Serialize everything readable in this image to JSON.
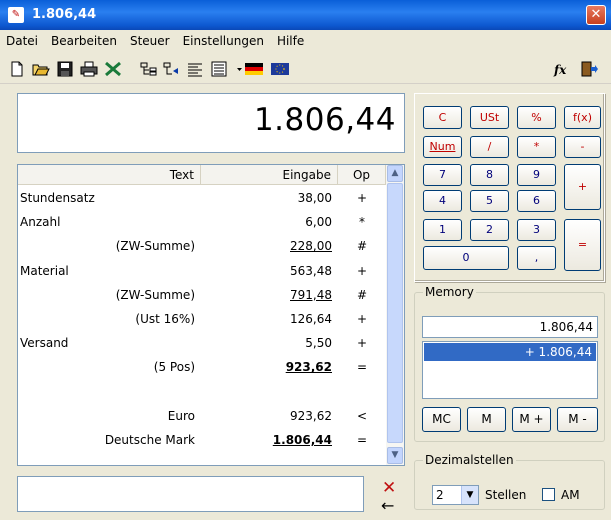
{
  "window": {
    "title": "1.806,44",
    "close_label": "✕"
  },
  "menu": [
    "Datei",
    "Bearbeiten",
    "Steuer",
    "Einstellungen",
    "Hilfe"
  ],
  "display": {
    "value": "1.806,44"
  },
  "grid": {
    "headers": {
      "text": "Text",
      "eingabe": "Eingabe",
      "op": "Op"
    },
    "rows": [
      {
        "text": "Stundensatz",
        "eingabe": "38,00",
        "op": "+"
      },
      {
        "text": "Anzahl",
        "eingabe": "6,00",
        "op": "*"
      },
      {
        "text": "(ZW-Summe)",
        "eingabe": "228,00",
        "op": "#"
      },
      {
        "text": "Material",
        "eingabe": "563,48",
        "op": "+"
      },
      {
        "text": "(ZW-Summe)",
        "eingabe": "791,48",
        "op": "#"
      },
      {
        "text": "(Ust 16%)",
        "eingabe": "126,64",
        "op": "+"
      },
      {
        "text": "Versand",
        "eingabe": "5,50",
        "op": "+"
      },
      {
        "text": "(5 Pos)",
        "eingabe": "923,62",
        "op": "="
      },
      {
        "text": "",
        "eingabe": "",
        "op": ""
      },
      {
        "text": "Euro",
        "eingabe": "923,62",
        "op": "<"
      },
      {
        "text": "Deutsche Mark",
        "eingabe": "1.806,44",
        "op": "="
      }
    ]
  },
  "input": {
    "value": ""
  },
  "keypad": {
    "c": "C",
    "ust": "USt",
    "percent": "%",
    "fx": "f(x)",
    "num": "Num",
    "divide": "/",
    "multiply": "*",
    "minus": "-",
    "k7": "7",
    "k8": "8",
    "k9": "9",
    "plus": "+",
    "k4": "4",
    "k5": "5",
    "k6": "6",
    "k1": "1",
    "k2": "2",
    "k3": "3",
    "equals": "=",
    "k0": "0",
    "comma": ","
  },
  "memory": {
    "label": "Memory",
    "display": "1.806,44",
    "items": [
      "+ 1.806,44"
    ],
    "buttons": {
      "mc": "MC",
      "m": "M",
      "mplus": "M +",
      "mminus": "M -"
    }
  },
  "decimals": {
    "label": "Dezimalstellen",
    "value": "2",
    "stellen_label": "Stellen",
    "am_label": "AM",
    "am_checked": false
  }
}
